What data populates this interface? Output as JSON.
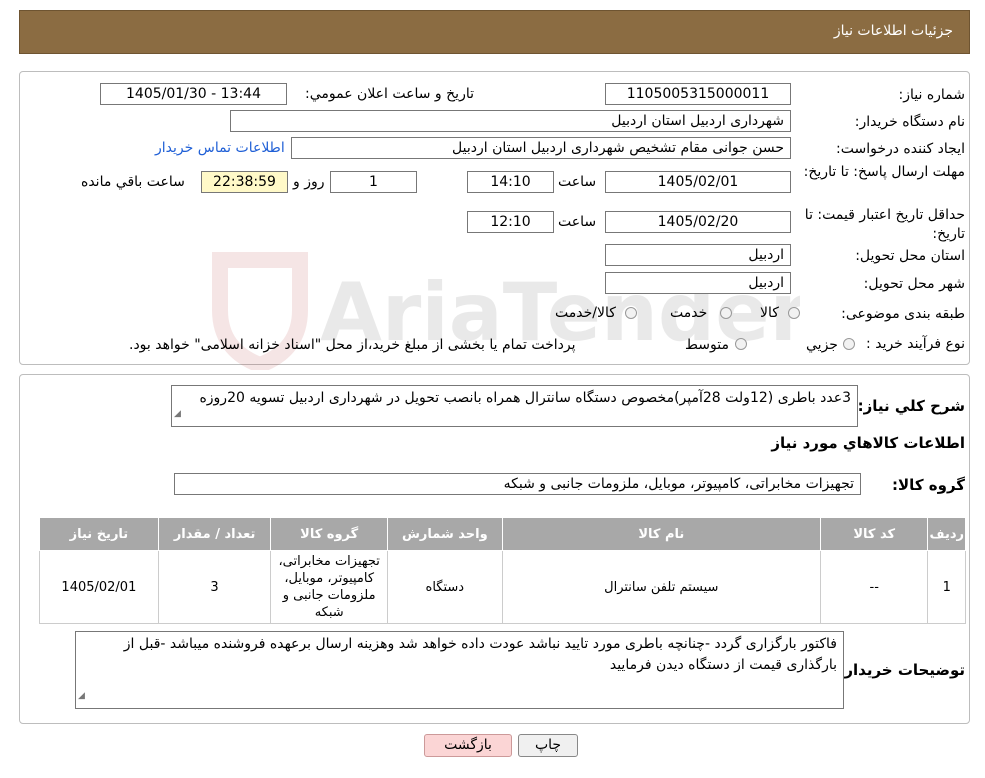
{
  "header": {
    "title": "جزئیات اطلاعات نیاز"
  },
  "form": {
    "need_number_label": "شماره نیاز:",
    "need_number": "1105005315000011",
    "announce_label": "تاریخ و ساعت اعلان عمومي:",
    "announce_value": "1405/01/30 - 13:44",
    "buyer_org_label": "نام دستگاه خريدار:",
    "buyer_org": "شهرداری اردبیل استان اردبیل",
    "requester_label": "ايجاد کننده درخواست:",
    "requester": "حسن جوانی مقام تشخیص شهرداری اردبیل استان اردبیل",
    "contact_link": "اطلاعات تماس خريدار",
    "deadline_label": "مهلت ارسال پاسخ: تا تاریخ:",
    "deadline_date": "1405/02/01",
    "time_label": "ساعت",
    "deadline_time": "14:10",
    "days_value": "1",
    "days_label": "روز و",
    "remaining_time": "22:38:59",
    "remaining_label": "ساعت باقي مانده",
    "validity_label": "حداقل تاریخ اعتبار قیمت: تا تاریخ:",
    "validity_date": "1405/02/20",
    "validity_time": "12:10",
    "province_label": "استان محل تحويل:",
    "province": "اردبیل",
    "city_label": "شهر محل تحويل:",
    "city": "اردبیل",
    "category_label": "طبقه بندی موضوعی:",
    "category_options": [
      "کالا",
      "خدمت",
      "کالا/خدمت"
    ],
    "process_label": "نوع فرآيند خريد :",
    "process_options": [
      "جزيي",
      "متوسط"
    ],
    "process_note": "پرداخت تمام یا بخشی از مبلغ خرید،از محل \"اسناد خزانه اسلامی\" خواهد بود."
  },
  "summary": {
    "label": "شرح کلي نياز:",
    "text": "3عدد باطری (12ولت 28آمپر)مخصوص دستگاه سانترال همراه بانصب تحویل در شهرداری اردبیل تسویه 20روزه"
  },
  "items_section": {
    "title": "اطلاعات کالاهاي مورد نياز",
    "group_label": "گروه کالا:",
    "group_value": "تجهیزات مخابراتی، کامپیوتر، موبایل، ملزومات جانبی و شبکه"
  },
  "table": {
    "headers": [
      "رديف",
      "کد کالا",
      "نام کالا",
      "واحد شمارش",
      "گروه کالا",
      "تعداد / مقدار",
      "تاريخ نياز"
    ],
    "rows": [
      [
        "1",
        "--",
        "سیستم تلفن سانترال",
        "دستگاه",
        "تجهیزات مخابراتی، کامپیوتر، موبایل، ملزومات جانبی و شبکه",
        "3",
        "1405/02/01"
      ]
    ]
  },
  "notes": {
    "label": "توضيحات خريدار:",
    "text": "فاکتور بارگزاری گردد -چنانچه باطری مورد تایید نباشد عودت داده خواهد شد وهزینه ارسال برعهده فروشنده میباشد -قبل از بارگذاری قیمت از دستگاه دیدن فرمایید"
  },
  "buttons": {
    "print": "چاپ",
    "back": "بازگشت"
  },
  "watermark": {
    "text": "AriaTender.neT"
  }
}
